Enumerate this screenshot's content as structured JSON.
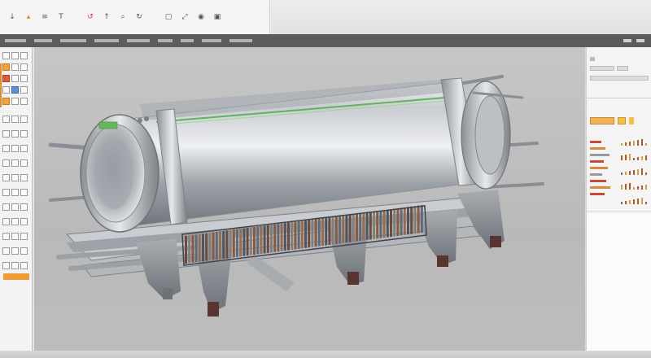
{
  "toolbar": {
    "buttons": [
      {
        "icon": "pin-icon",
        "glyph": "↓",
        "tone": "plain"
      },
      {
        "icon": "flag-icon",
        "glyph": "▴",
        "tone": "hot"
      },
      {
        "icon": "grid-icon",
        "glyph": "≡",
        "tone": "plain"
      },
      {
        "icon": "text-icon",
        "glyph": "T",
        "tone": "plain"
      },
      {
        "icon": "undo-icon",
        "glyph": "↺",
        "tone": "red"
      },
      {
        "icon": "up-icon",
        "glyph": "↑",
        "tone": "plain"
      },
      {
        "icon": "search-icon",
        "glyph": "⌕",
        "tone": "plain"
      },
      {
        "icon": "rotate-icon",
        "glyph": "↻",
        "tone": "plain"
      },
      {
        "icon": "image-icon",
        "glyph": "▢",
        "tone": "plain"
      },
      {
        "icon": "fit-icon",
        "glyph": "⤢",
        "tone": "plain"
      },
      {
        "icon": "node-icon",
        "glyph": "◉",
        "tone": "plain"
      },
      {
        "icon": "shape-icon",
        "glyph": "▣",
        "tone": "plain"
      }
    ]
  },
  "menubar": {
    "items": [
      "",
      "",
      "",
      "",
      "",
      "",
      "",
      "",
      ""
    ],
    "right": [
      "",
      ""
    ]
  },
  "colors": {
    "accent": "#e48b2a",
    "menubar": "#5c5c5c",
    "viewport": "#c2c2c2",
    "cylinder_highlight": "#5fb35a"
  },
  "right_panel": {
    "header_label": "",
    "header_sub": "",
    "section_title": "",
    "list_labels": [
      "",
      "",
      "",
      "",
      ""
    ]
  }
}
